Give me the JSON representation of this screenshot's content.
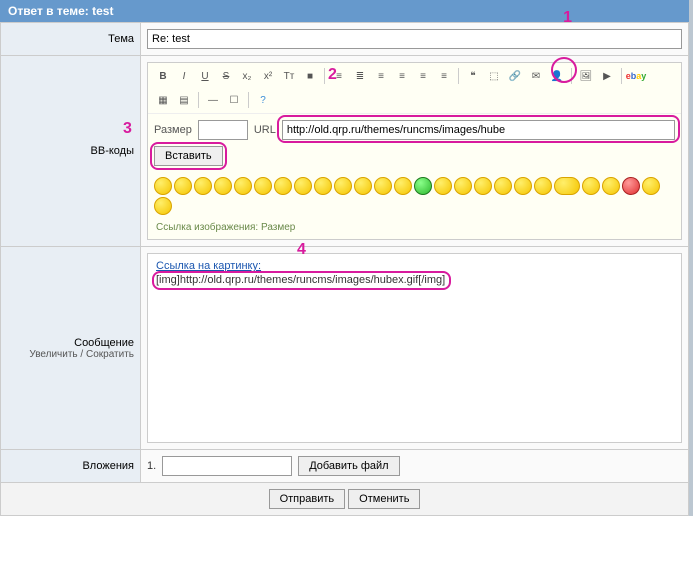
{
  "header": {
    "title": "Ответ в теме: test"
  },
  "annotations": {
    "a1": "1",
    "a2": "2",
    "a3": "3",
    "a4": "4"
  },
  "rows": {
    "topic_label": "Тема",
    "topic_value": "Re: test",
    "bb_label": "BB-коды",
    "msg_label": "Сообщение",
    "msg_sub": "Увеличить / Сократить",
    "attach_label": "Вложения"
  },
  "editor": {
    "size_label": "Размер",
    "url_label": "URL",
    "url_value": "http://old.qrp.ru/themes/runcms/images/hube",
    "insert_btn": "Вставить",
    "hint": "Ссылка изображения: Размер"
  },
  "message": {
    "label": "Ссылка на картинку:",
    "content": "[img]http://old.qrp.ru/themes/runcms/images/hubex.gif[/img]"
  },
  "attach": {
    "index": "1.",
    "add": "Добавить файл"
  },
  "buttons": {
    "submit": "Отправить",
    "cancel": "Отменить"
  }
}
